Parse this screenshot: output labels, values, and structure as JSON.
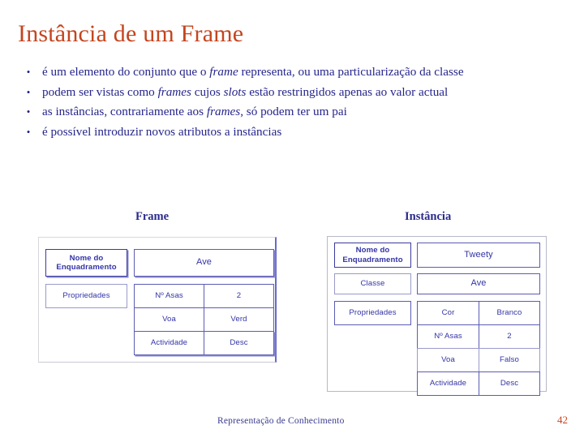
{
  "slide": {
    "title": "Instância de um Frame",
    "footer_text": "Representação de Conhecimento",
    "page_number": "42",
    "title_color": "#C4451F",
    "body_color": "#25258C",
    "cell_text_color": "#3333A8"
  },
  "bullets": [
    {
      "marker": "•",
      "segments": [
        {
          "text": "é um elemento do conjunto que o ",
          "italic": false
        },
        {
          "text": "frame",
          "italic": true
        },
        {
          "text": " representa, ou uma particularização da classe",
          "italic": false
        }
      ]
    },
    {
      "marker": "•",
      "segments": [
        {
          "text": "podem ser vistas como ",
          "italic": false
        },
        {
          "text": "frames",
          "italic": true
        },
        {
          "text": " cujos ",
          "italic": false
        },
        {
          "text": "slots",
          "italic": true
        },
        {
          "text": " estão restringidos apenas ao valor actual",
          "italic": false
        }
      ]
    },
    {
      "marker": "•",
      "segments": [
        {
          "text": "as instâncias, contrariamente aos ",
          "italic": false
        },
        {
          "text": "frames",
          "italic": true
        },
        {
          "text": ", só podem ter um pai",
          "italic": false
        }
      ]
    },
    {
      "marker": "•",
      "segments": [
        {
          "text": "é possível introduzir novos atributos a instâncias",
          "italic": false
        }
      ]
    }
  ],
  "frame_diagram": {
    "heading": "Frame",
    "label_name": "Nome do Enquadramento",
    "label_name_line1": "Nome do",
    "label_name_line2": "Enquadramento",
    "value_name": "Ave",
    "label_properties": "Propriedades",
    "properties": [
      {
        "slot": "Nº Asas",
        "value": "2"
      },
      {
        "slot": "Voa",
        "value": "Verd"
      },
      {
        "slot": "Actividade",
        "value": "Desc"
      }
    ]
  },
  "instance_diagram": {
    "heading": "Instância",
    "label_name_line1": "Nome do",
    "label_name_line2": "Enquadramento",
    "value_name": "Tweety",
    "label_class": "Classe",
    "value_class": "Ave",
    "label_properties": "Propriedades",
    "properties": [
      {
        "slot": "Cor",
        "value": "Branco"
      },
      {
        "slot": "Nº Asas",
        "value": "2"
      },
      {
        "slot": "Voa",
        "value": "Falso"
      },
      {
        "slot": "Actividade",
        "value": "Desc"
      }
    ]
  }
}
